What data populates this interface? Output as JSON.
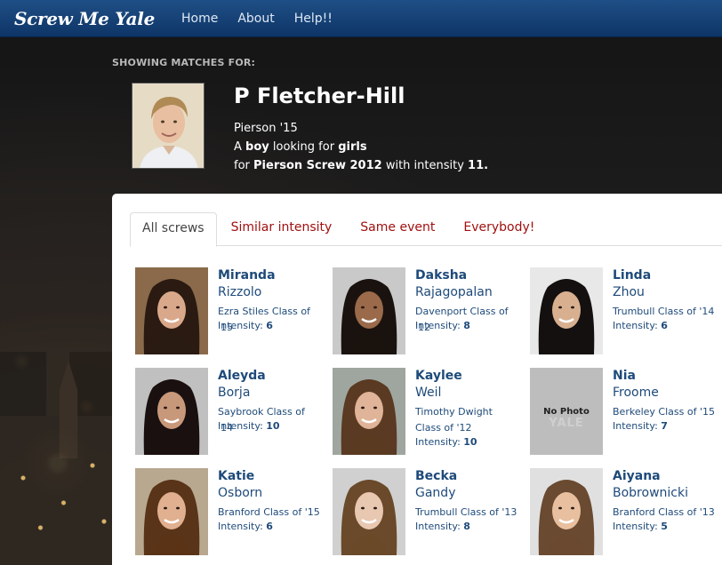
{
  "nav": {
    "brand": "Screw Me Yale",
    "links": [
      "Home",
      "About",
      "Help!!"
    ]
  },
  "header": {
    "showing_label": "SHOWING MATCHES FOR:",
    "name": "P Fletcher-Hill",
    "college": "Pierson '15",
    "line2_prefix": "A ",
    "gender": "boy",
    "line2_mid": " looking for ",
    "preference": "girls",
    "line3_prefix": "for ",
    "event": "Pierson Screw 2012",
    "line3_mid": " with intensity ",
    "intensity": "11."
  },
  "tabs": [
    "All screws",
    "Similar intensity",
    "Same event",
    "Everybody!"
  ],
  "intensity_label": "Intensity: ",
  "no_photo": {
    "label": "No Photo",
    "watermark": "YALE"
  },
  "matches": [
    {
      "first": "Miranda",
      "last": "Rizzolo",
      "class": "Ezra Stiles Class of '15",
      "intensity": "6"
    },
    {
      "first": "Daksha",
      "last": "Rajagopalan",
      "class": "Davenport Class of '12",
      "intensity": "8"
    },
    {
      "first": "Linda",
      "last": "Zhou",
      "class": "Trumbull Class of '14",
      "intensity": "6"
    },
    {
      "first": "Aleyda",
      "last": "Borja",
      "class": "Saybrook Class of '14",
      "intensity": "10"
    },
    {
      "first": "Kaylee",
      "last": "Weil",
      "class": "Timothy Dwight Class of '12",
      "intensity": "10"
    },
    {
      "first": "Nia",
      "last": "Froome",
      "class": "Berkeley Class of '15",
      "intensity": "7"
    },
    {
      "first": "Katie",
      "last": "Osborn",
      "class": "Branford Class of '15",
      "intensity": "6"
    },
    {
      "first": "Becka",
      "last": "Gandy",
      "class": "Trumbull Class of '13",
      "intensity": "8"
    },
    {
      "first": "Aiyana",
      "last": "Bobrownicki",
      "class": "Branford Class of '13",
      "intensity": "5"
    }
  ]
}
